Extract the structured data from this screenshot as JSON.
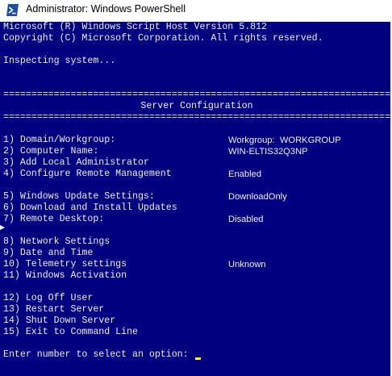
{
  "window": {
    "title": "Administrator: Windows PowerShell"
  },
  "console": {
    "header_line1": "Microsoft (R) Windows Script Host Version 5.812",
    "header_line2": "Copyright (C) Microsoft Corporation. All rights reserved.",
    "status": "Inspecting system...",
    "separator": "================================================================================",
    "section_title": "Server Configuration",
    "menu": [
      {
        "label": "1) Domain/Workgroup:",
        "value": "Workgroup:  WORKGROUP"
      },
      {
        "label": "2) Computer Name:",
        "value": "WIN-ELTIS32Q3NP"
      },
      {
        "label": "3) Add Local Administrator",
        "value": ""
      },
      {
        "label": "4) Configure Remote Management",
        "value": "Enabled"
      },
      {
        "label": "5) Windows Update Settings:",
        "value": "DownloadOnly"
      },
      {
        "label": "6) Download and Install Updates",
        "value": ""
      },
      {
        "label": "7) Remote Desktop:",
        "value": "Disabled"
      },
      {
        "label": "8) Network Settings",
        "value": ""
      },
      {
        "label": "9) Date and Time",
        "value": ""
      },
      {
        "label": "10) Telemetry settings",
        "value": "Unknown"
      },
      {
        "label": "11) Windows Activation",
        "value": ""
      },
      {
        "label": "12) Log Off User",
        "value": ""
      },
      {
        "label": "13) Restart Server",
        "value": ""
      },
      {
        "label": "14) Shut Down Server",
        "value": ""
      },
      {
        "label": "15) Exit to Command Line",
        "value": ""
      }
    ],
    "prompt": "Enter number to select an option:"
  },
  "colors": {
    "console_background": "#000080",
    "console_text": "#eeedf0",
    "cursor": "#ffff00"
  },
  "icons": {
    "app_icon": "powershell-icon"
  }
}
